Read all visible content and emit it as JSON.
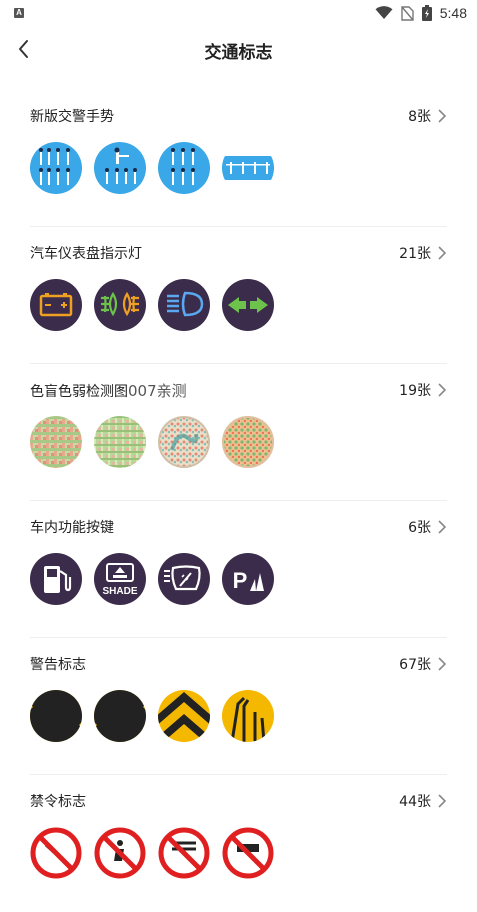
{
  "status": {
    "time": "5:48"
  },
  "nav": {
    "title": "交通标志"
  },
  "sections": [
    {
      "title": "新版交警手势",
      "title_suffix": "",
      "count": "8张",
      "icons": [
        "traffic-police-gesture-icon",
        "traffic-police-gesture-icon",
        "traffic-police-gesture-icon",
        "traffic-police-gesture-icon"
      ]
    },
    {
      "title": "汽车仪表盘指示灯",
      "title_suffix": "",
      "count": "21张",
      "icons": [
        "battery-warning-icon",
        "fog-light-icon",
        "headlight-icon",
        "turn-signal-icon"
      ]
    },
    {
      "title": "色盲色弱检测图",
      "title_suffix": "007亲测",
      "count": "19张",
      "icons": [
        "color-plate-icon",
        "color-plate-icon",
        "color-plate-icon",
        "color-plate-icon"
      ]
    },
    {
      "title": "车内功能按键",
      "title_suffix": "",
      "count": "6张",
      "icons": [
        "fuel-icon",
        "sunshade-icon",
        "wiper-washer-icon",
        "parking-sensor-icon"
      ]
    },
    {
      "title": "警告标志",
      "title_suffix": "",
      "count": "67张",
      "icons": [
        "hazard-stripes-icon",
        "hazard-stripes-icon",
        "chevron-warning-icon",
        "road-lanes-icon"
      ]
    },
    {
      "title": "禁令标志",
      "title_suffix": "",
      "count": "44张",
      "icons": [
        "prohibition-sign-icon",
        "prohibition-sign-icon",
        "prohibition-sign-icon",
        "prohibition-sign-icon"
      ]
    }
  ],
  "colors": {
    "gesture_bg": "#3aa8e8",
    "dash_bg": "#3a2c4a",
    "warning_yellow": "#f5b800",
    "prohibit_red": "#e02020"
  }
}
